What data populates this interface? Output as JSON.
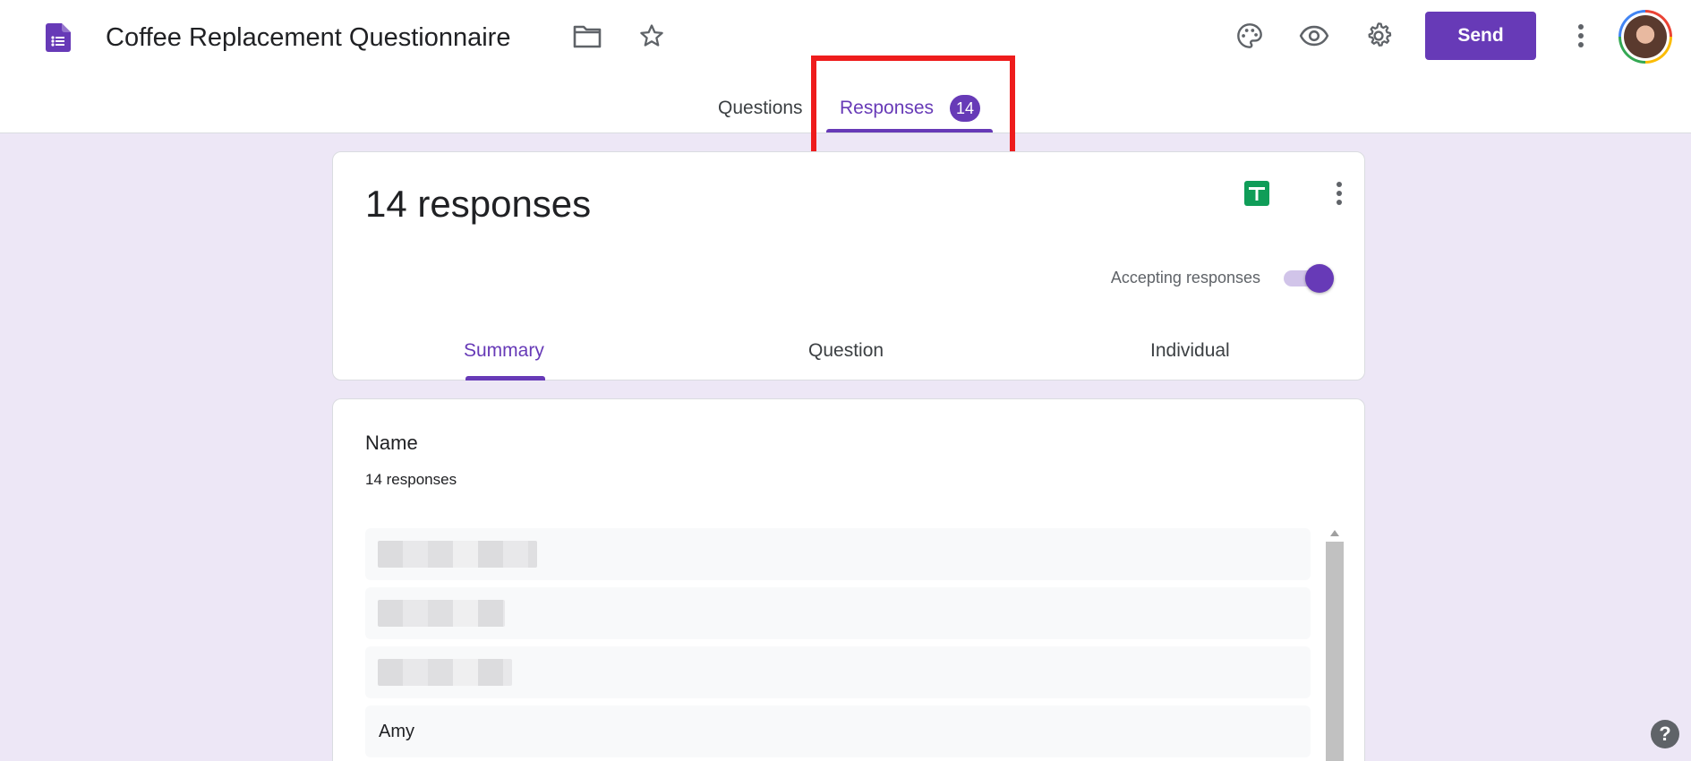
{
  "header": {
    "title": "Coffee Replacement Questionnaire",
    "send_label": "Send",
    "icons": [
      "forms-icon",
      "folder-icon",
      "star-icon",
      "palette-icon",
      "eye-icon",
      "gear-icon",
      "more-vert-icon"
    ]
  },
  "tabs": {
    "questions": "Questions",
    "responses": "Responses",
    "responses_badge": "14"
  },
  "summary_card": {
    "count_text": "14 responses",
    "accepting_label": "Accepting responses",
    "accepting_on": true,
    "subtabs": [
      "Summary",
      "Question",
      "Individual"
    ]
  },
  "question_card": {
    "title": "Name",
    "count_text": "14 responses",
    "answers": [
      "",
      "",
      "",
      "Amy"
    ]
  },
  "help_label": "?",
  "colors": {
    "accent": "#673ab7",
    "background": "#ede7f6",
    "highlight": "#ee1c1c",
    "sheets_green": "#0f9d58"
  }
}
